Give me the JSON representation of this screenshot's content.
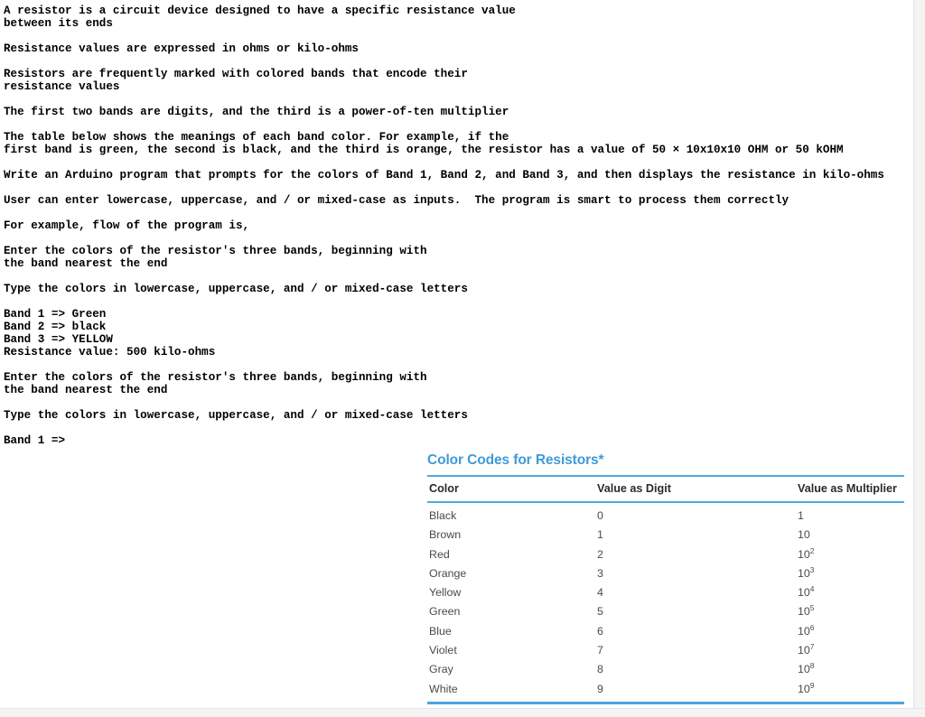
{
  "problem": {
    "paragraphs": [
      "A resistor is a circuit device designed to have a specific resistance value\nbetween its ends",
      "Resistance values are expressed in ohms or kilo-ohms",
      "Resistors are frequently marked with colored bands that encode their\nresistance values",
      "The first two bands are digits, and the third is a power-of-ten multiplier",
      "The table below shows the meanings of each band color. For example, if the\nfirst band is green, the second is black, and the third is orange, the resistor has a value of 50 × 10x10x10 OHM or 50 kOHM",
      "Write an Arduino program that prompts for the colors of Band 1, Band 2, and Band 3, and then displays the resistance in kilo-ohms",
      "User can enter lowercase, uppercase, and / or mixed-case as inputs.  The program is smart to process them correctly",
      "For example, flow of the program is,",
      "Enter the colors of the resistor's three bands, beginning with\nthe band nearest the end",
      "Type the colors in lowercase, uppercase, and / or mixed-case letters",
      "Band 1 => Green\nBand 2 => black\nBand 3 => YELLOW\nResistance value: 500 kilo-ohms",
      "Enter the colors of the resistor's three bands, beginning with\nthe band nearest the end",
      "Type the colors in lowercase, uppercase, and / or mixed-case letters",
      "Band 1 =>"
    ]
  },
  "table": {
    "title": "Color Codes for Resistors*",
    "accent_color": "#4fa8dd",
    "title_color": "#3f9ad8",
    "columns": [
      "Color",
      "Value as Digit",
      "Value as Multiplier"
    ],
    "rows": [
      {
        "color": "Black",
        "digit": "0",
        "multiplier_base": "1",
        "multiplier_exp": ""
      },
      {
        "color": "Brown",
        "digit": "1",
        "multiplier_base": "10",
        "multiplier_exp": ""
      },
      {
        "color": "Red",
        "digit": "2",
        "multiplier_base": "10",
        "multiplier_exp": "2"
      },
      {
        "color": "Orange",
        "digit": "3",
        "multiplier_base": "10",
        "multiplier_exp": "3"
      },
      {
        "color": "Yellow",
        "digit": "4",
        "multiplier_base": "10",
        "multiplier_exp": "4"
      },
      {
        "color": "Green",
        "digit": "5",
        "multiplier_base": "10",
        "multiplier_exp": "5"
      },
      {
        "color": "Blue",
        "digit": "6",
        "multiplier_base": "10",
        "multiplier_exp": "6"
      },
      {
        "color": "Violet",
        "digit": "7",
        "multiplier_base": "10",
        "multiplier_exp": "7"
      },
      {
        "color": "Gray",
        "digit": "8",
        "multiplier_base": "10",
        "multiplier_exp": "8"
      },
      {
        "color": "White",
        "digit": "9",
        "multiplier_base": "10",
        "multiplier_exp": "9"
      }
    ]
  }
}
